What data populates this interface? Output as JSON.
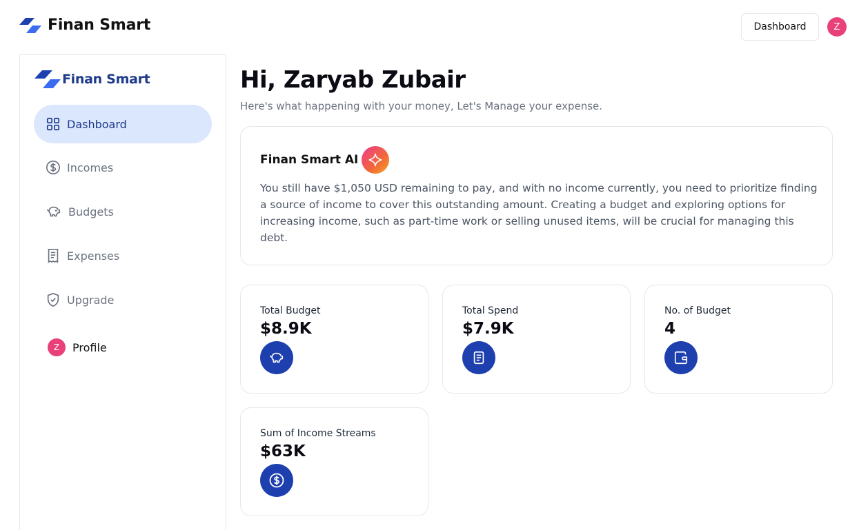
{
  "header": {
    "brand": "Finan Smart",
    "dashboard_button": "Dashboard",
    "avatar_initial": "Z"
  },
  "sidebar": {
    "brand": "Finan Smart",
    "items": [
      {
        "label": "Dashboard",
        "icon": "grid-icon",
        "active": true
      },
      {
        "label": "Incomes",
        "icon": "dollar-circle-icon",
        "active": false
      },
      {
        "label": "Budgets",
        "icon": "piggy-bank-icon",
        "active": false
      },
      {
        "label": "Expenses",
        "icon": "receipt-icon",
        "active": false
      },
      {
        "label": "Upgrade",
        "icon": "shield-check-icon",
        "active": false
      }
    ],
    "profile": {
      "initial": "Z",
      "label": "Profile"
    }
  },
  "main": {
    "greeting": "Hi, Zaryab Zubair",
    "subtitle": "Here's what happening with your money, Let's Manage your expense.",
    "ai_card": {
      "title": "Finan Smart AI",
      "icon": "sparkle-icon",
      "message": "You still have $1,050 USD remaining to pay, and with no income currently, you need to prioritize finding a source of income to cover this outstanding amount. Creating a budget and exploring options for increasing income, such as part-time work or selling unused items, will be crucial for managing this debt."
    },
    "stats": [
      {
        "label": "Total Budget",
        "value": "$8.9K",
        "icon": "piggy-bank-icon"
      },
      {
        "label": "Total Spend",
        "value": "$7.9K",
        "icon": "receipt-icon"
      },
      {
        "label": "No. of Budget",
        "value": "4",
        "icon": "wallet-icon"
      },
      {
        "label": "Sum of Income Streams",
        "value": "$63K",
        "icon": "dollar-circle-icon"
      }
    ]
  },
  "colors": {
    "accent": "#1e40af",
    "brand_text": "#1e3a8a",
    "active_nav_bg": "#dbe7fd",
    "avatar": "#e9407a"
  }
}
